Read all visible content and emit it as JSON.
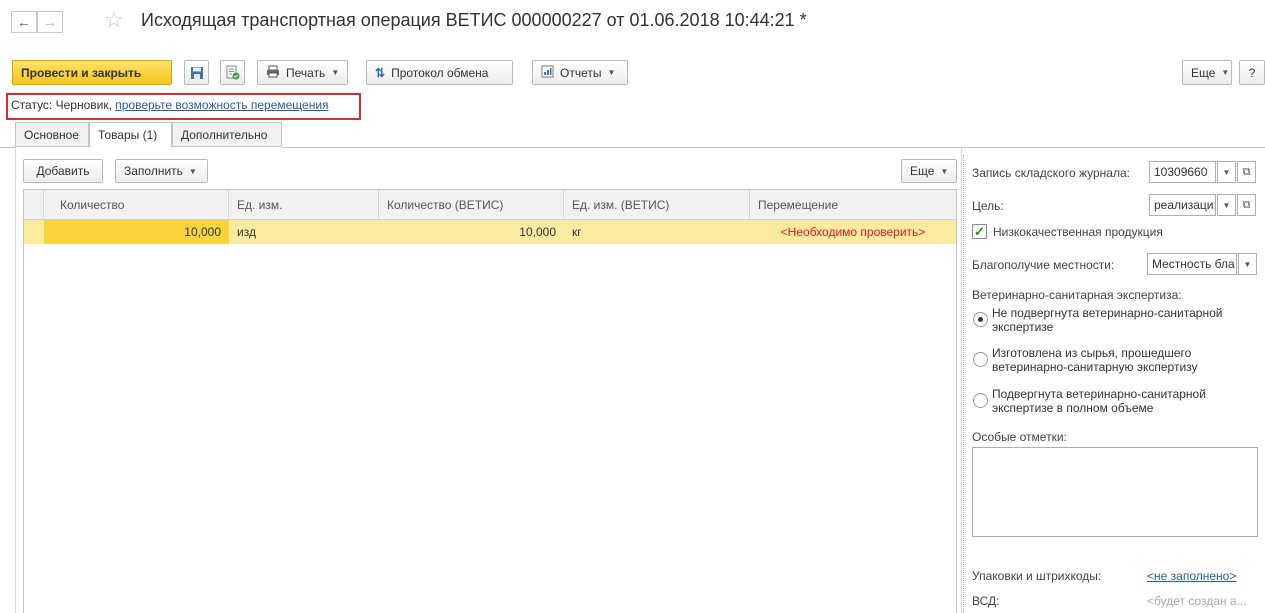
{
  "window": {
    "title": "Исходящая транспортная операция ВЕТИС 000000227 от 01.06.2018 10:44:21 *"
  },
  "toolbar": {
    "post_close": "Провести и закрыть",
    "print": "Печать",
    "exchange_log": "Протокол обмена",
    "reports": "Отчеты",
    "more": "Еще",
    "help": "?"
  },
  "status": {
    "label": "Статус: Черновик, ",
    "link": "проверьте возможность перемещения"
  },
  "tabs": [
    {
      "label": "Основное",
      "active": false
    },
    {
      "label": "Товары (1)",
      "active": true
    },
    {
      "label": "Дополнительно",
      "active": false
    }
  ],
  "table_toolbar": {
    "add": "Добавить",
    "fill": "Заполнить",
    "more": "Еще"
  },
  "table": {
    "columns": [
      "Количество",
      "Ед. изм.",
      "Количество (ВЕТИС)",
      "Ед. изм. (ВЕТИС)",
      "Перемещение"
    ],
    "rows": [
      {
        "qty": "10,000",
        "unit": "изд",
        "qty_vetis": "10,000",
        "unit_vetis": "кг",
        "transfer": "<Необходимо проверить>"
      }
    ]
  },
  "side": {
    "journal_label": "Запись складского журнала:",
    "journal_value": "10309660",
    "goal_label": "Цель:",
    "goal_value": "реализаци:",
    "low_quality_label": "Низкокачественная продукция",
    "low_quality_checked": true,
    "wellbeing_label": "Благополучие местности:",
    "wellbeing_value": "Местность бла",
    "expertise_label": "Ветеринарно-санитарная экспертиза:",
    "expertise_options": [
      {
        "label": "Не подвергнута ветеринарно-санитарной экспертизе",
        "selected": true
      },
      {
        "label": "Изготовлена из сырья, прошедшего ветеринарно-санитарную экспертизу",
        "selected": false
      },
      {
        "label": "Подвергнута ветеринарно-санитарной экспертизе в полном объеме",
        "selected": false
      }
    ],
    "notes_label": "Особые отметки:",
    "notes_value": "",
    "packages_label": "Упаковки и штрихкоды:",
    "packages_value": "<не заполнено>",
    "vsd_label": "ВСД:",
    "vsd_value": "<будет создан а..."
  },
  "colors": {
    "primary_button": "#f5c51a",
    "selected_row": "#fbeba0",
    "active_cell": "#f8d43a",
    "warning_text": "#e01b1b",
    "link": "#2a5aa8",
    "status_highlight": "#e0282f"
  }
}
